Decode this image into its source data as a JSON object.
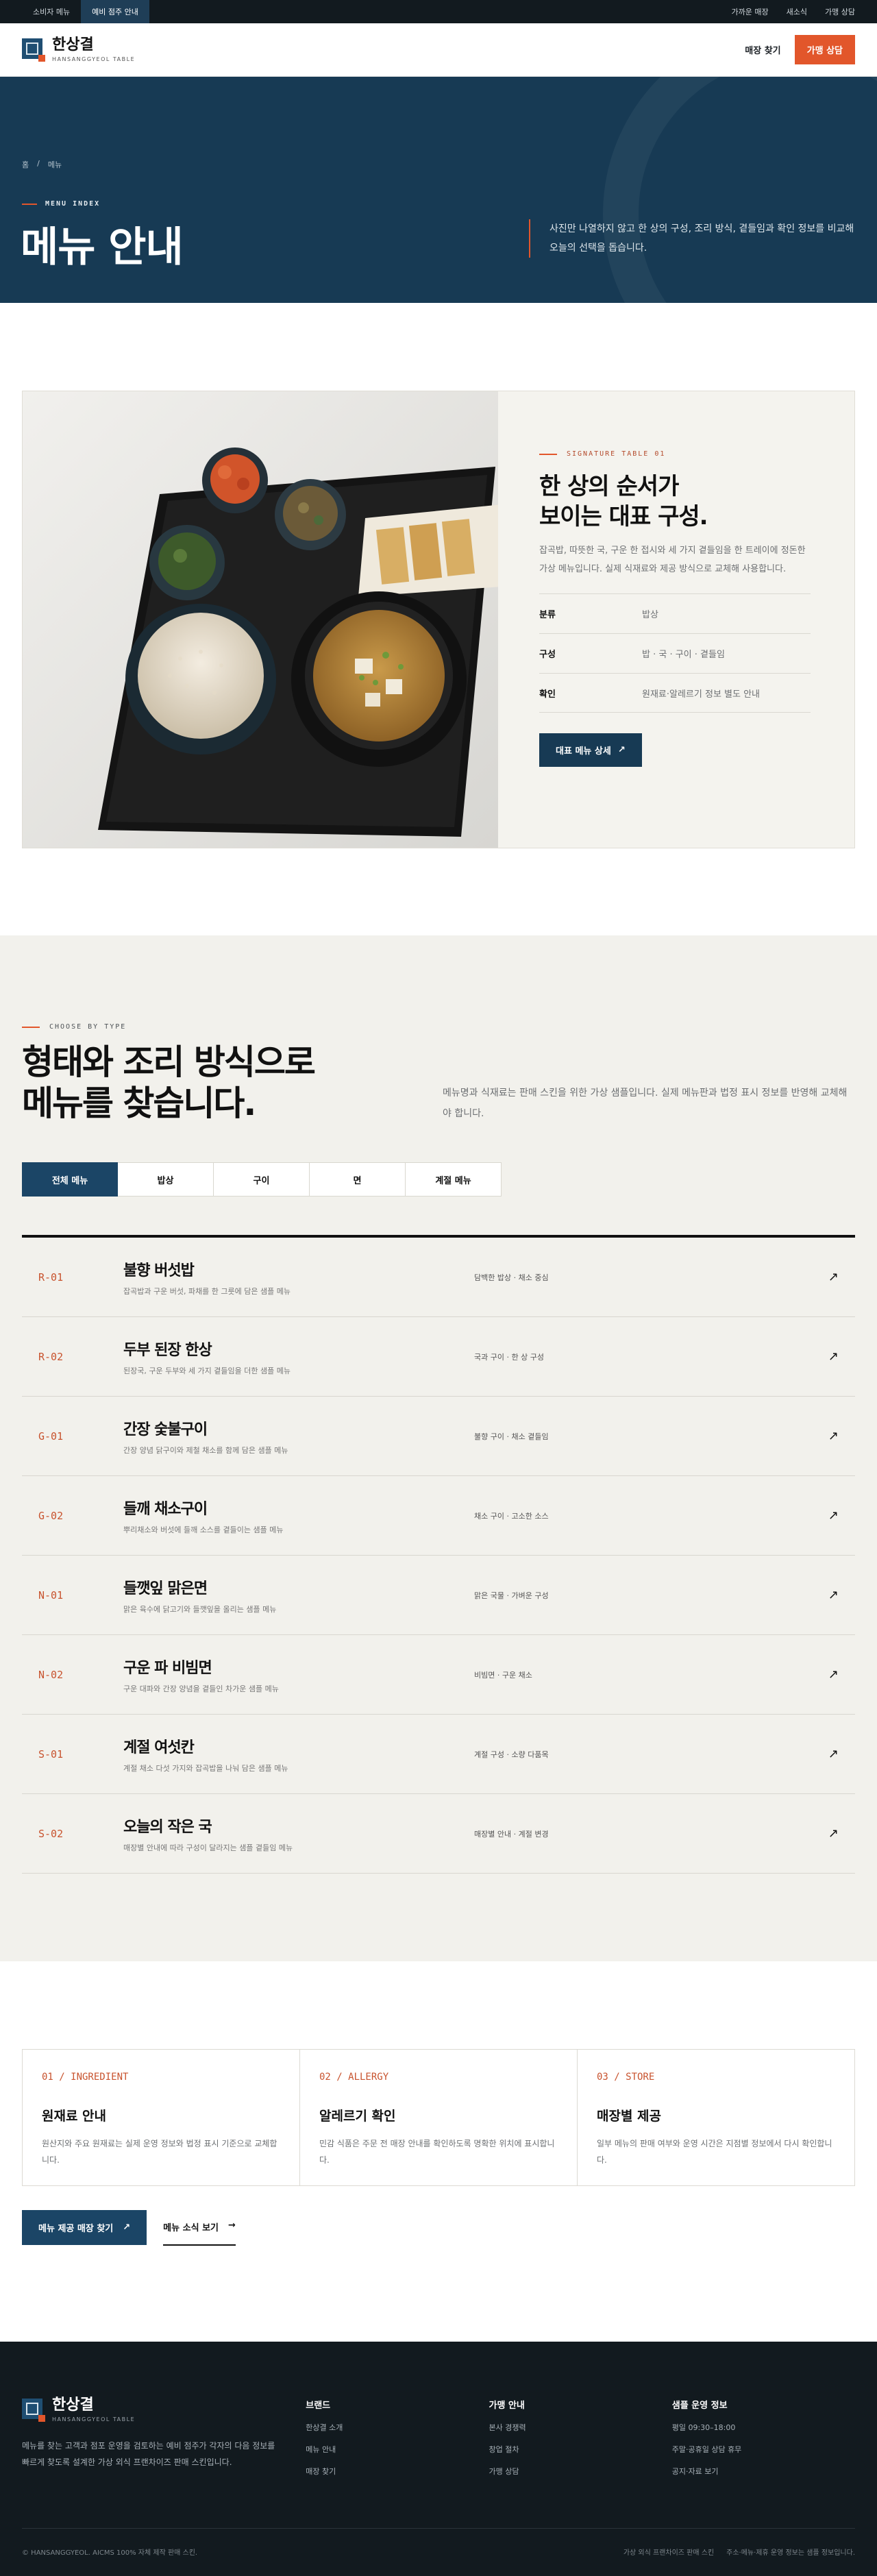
{
  "topbar": {
    "tabs": [
      "소비자 메뉴",
      "예비 점주 안내"
    ],
    "links": [
      "가까운 매장",
      "새소식",
      "가맹 상담"
    ]
  },
  "header": {
    "brand_name": "한상결",
    "brand_sub": "HANSANGGYEOL TABLE",
    "find_store": "매장 찾기",
    "cta": "가맹 상담"
  },
  "hero": {
    "breadcrumb": [
      "홈",
      "/",
      "메뉴"
    ],
    "eyebrow": "MENU INDEX",
    "title": "메뉴 안내",
    "description": "사진만 나열하지 않고 한 상의 구성, 조리 방식, 곁들임과 확인 정보를 비교해 오늘의 선택을 돕습니다."
  },
  "signature": {
    "eyebrow": "SIGNATURE TABLE 01",
    "title_line1": "한 상의 순서가",
    "title_line2": "보이는 대표 구성.",
    "description": "잡곡밥, 따뜻한 국, 구운 한 접시와 세 가지 곁들임을 한 트레이에 정돈한 가상 메뉴입니다. 실제 식재료와 제공 방식으로 교체해 사용합니다.",
    "spec": [
      {
        "key": "분류",
        "value": "밥상"
      },
      {
        "key": "구성",
        "value": "밥 · 국 · 구이 · 곁들임"
      },
      {
        "key": "확인",
        "value": "원재료·알레르기 정보 별도 안내"
      }
    ],
    "button": "대표 메뉴 상세",
    "button_icon": "↗"
  },
  "menu": {
    "eyebrow": "CHOOSE BY TYPE",
    "title_line1": "형태와 조리 방식으로",
    "title_line2": "메뉴를 찾습니다.",
    "description": "메뉴명과 식재료는 판매 스킨을 위한 가상 샘플입니다. 실제 메뉴판과 법정 표시 정보를 반영해 교체해야 합니다.",
    "filters": [
      "전체 메뉴",
      "밥상",
      "구이",
      "면",
      "계절 메뉴"
    ],
    "items": [
      {
        "code": "R-01",
        "name": "불향 버섯밥",
        "desc": "잡곡밥과 구운 버섯, 파채를 한 그릇에 담은 샘플 메뉴",
        "tag": "담백한 밥상 · 채소 중심"
      },
      {
        "code": "R-02",
        "name": "두부 된장 한상",
        "desc": "된장국, 구운 두부와 세 가지 곁들임을 더한 샘플 메뉴",
        "tag": "국과 구이 · 한 상 구성"
      },
      {
        "code": "G-01",
        "name": "간장 숯불구이",
        "desc": "간장 양념 닭구이와 제철 채소를 함께 담은 샘플 메뉴",
        "tag": "불향 구이 · 채소 곁들임"
      },
      {
        "code": "G-02",
        "name": "들깨 채소구이",
        "desc": "뿌리채소와 버섯에 들깨 소스를 곁들이는 샘플 메뉴",
        "tag": "채소 구이 · 고소한 소스"
      },
      {
        "code": "N-01",
        "name": "들깻잎 맑은면",
        "desc": "맑은 육수에 닭고기와 들깻잎을 올리는 샘플 메뉴",
        "tag": "맑은 국물 · 가벼운 구성"
      },
      {
        "code": "N-02",
        "name": "구운 파 비빔면",
        "desc": "구운 대파와 간장 양념을 곁들인 차가운 샘플 메뉴",
        "tag": "비빔면 · 구운 채소"
      },
      {
        "code": "S-01",
        "name": "계절 여섯칸",
        "desc": "계절 채소 다섯 가지와 잡곡밥을 나눠 담은 샘플 메뉴",
        "tag": "계절 구성 · 소량 다품목"
      },
      {
        "code": "S-02",
        "name": "오늘의 작은 국",
        "desc": "매장별 안내에 따라 구성이 달라지는 샘플 곁들임 메뉴",
        "tag": "매장별 안내 · 계절 변경"
      }
    ],
    "arrow_icon": "↗"
  },
  "info": {
    "cards": [
      {
        "num": "01 / INGREDIENT",
        "title": "원재료 안내",
        "desc": "원산지와 주요 원재료는 실제 운영 정보와 법정 표시 기준으로 교체합니다."
      },
      {
        "num": "02 / ALLERGY",
        "title": "알레르기 확인",
        "desc": "민감 식품은 주문 전 매장 안내를 확인하도록 명확한 위치에 표시합니다."
      },
      {
        "num": "03 / STORE",
        "title": "매장별 제공",
        "desc": "일부 메뉴의 판매 여부와 운영 시간은 지점별 정보에서 다시 확인합니다."
      }
    ],
    "button_primary": "메뉴 제공 매장 찾기",
    "button_primary_icon": "↗",
    "button_secondary": "메뉴 소식 보기",
    "button_secondary_icon": "→"
  },
  "footer": {
    "brand_name": "한상결",
    "brand_sub": "HANSANGGYEOL TABLE",
    "description": "메뉴를 찾는 고객과 점포 운영을 검토하는 예비 점주가 각자의 다음 정보를 빠르게 찾도록 설계한 가상 외식 프랜차이즈 판매 스킨입니다.",
    "columns": [
      {
        "heading": "브랜드",
        "items": [
          "한상결 소개",
          "메뉴 안내",
          "매장 찾기"
        ]
      },
      {
        "heading": "가맹 안내",
        "items": [
          "본사 경쟁력",
          "창업 절차",
          "가맹 상담"
        ]
      },
      {
        "heading": "샘플 운영 정보",
        "items": [
          "평일 09:30–18:00",
          "주말·공휴일 상담 휴무",
          "공지·자료 보기"
        ]
      }
    ],
    "copyright": "© HANSANGGYEOL. AICMS 100% 자체 제작 판매 스킨.",
    "bottom_links": [
      "가상 외식 프랜차이즈 판매 스킨",
      "주소·메뉴·제휴 운영 정보는 샘플 정보입니다."
    ]
  }
}
